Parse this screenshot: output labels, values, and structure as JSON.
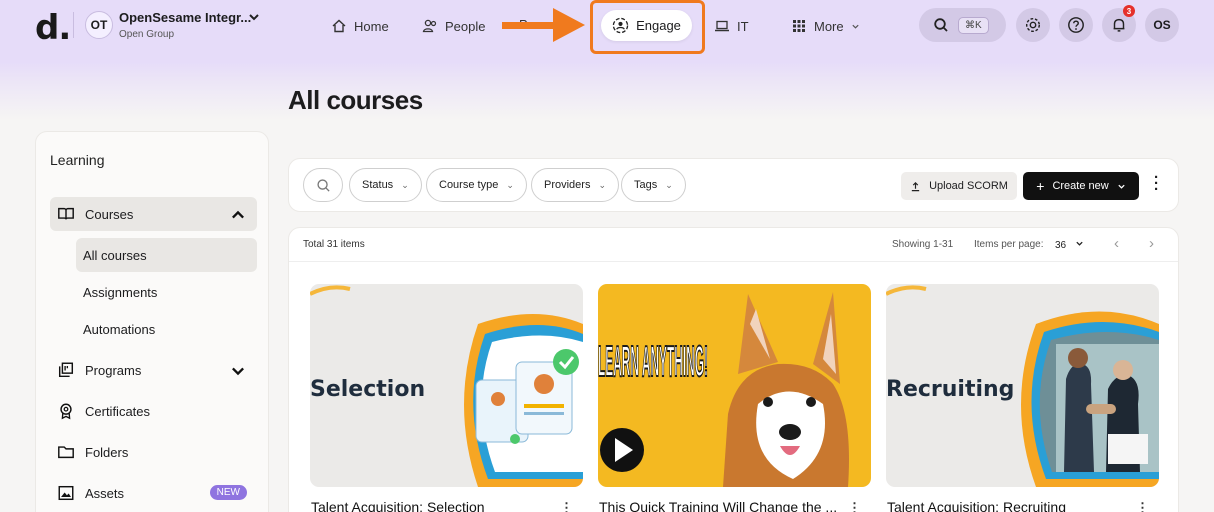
{
  "topbar": {
    "logo": "d.",
    "org": {
      "initials": "OT",
      "name": "OpenSesame Integr...",
      "subtitle": "Open Group"
    },
    "nav": [
      {
        "label": "Home",
        "icon": "home-icon"
      },
      {
        "label": "People",
        "icon": "people-icon"
      },
      {
        "label": "Engage",
        "icon": "engage-icon",
        "active": true
      },
      {
        "label": "IT",
        "icon": "laptop-icon"
      },
      {
        "label": "More",
        "icon": "grid-icon"
      }
    ],
    "partial_nav_text": "P",
    "search_shortcut": "⌘K",
    "notification_count": "3",
    "user_initials": "OS",
    "highlight_color": "#f07a1e",
    "accent_bg": "#e6dcf9"
  },
  "page": {
    "title": "All courses"
  },
  "sidebar": {
    "heading": "Learning",
    "items": [
      {
        "label": "Courses",
        "icon": "book-icon",
        "expanded": true
      },
      {
        "label": "Programs",
        "icon": "programs-icon"
      },
      {
        "label": "Certificates",
        "icon": "certificate-icon"
      },
      {
        "label": "Folders",
        "icon": "folder-icon"
      },
      {
        "label": "Assets",
        "icon": "image-icon",
        "badge": "NEW"
      }
    ],
    "sub_items": [
      {
        "label": "All courses",
        "active": true
      },
      {
        "label": "Assignments"
      },
      {
        "label": "Automations"
      }
    ]
  },
  "filters": {
    "chips": [
      "Status",
      "Course type",
      "Providers",
      "Tags"
    ],
    "upload_label": "Upload SCORM",
    "create_label": "Create new"
  },
  "list": {
    "total": "Total 31 items",
    "showing": "Showing 1-31",
    "per_page_label": "Items per page:",
    "per_page_value": "36"
  },
  "cards": [
    {
      "title": "Talent Acquisition: Selection",
      "thumb_text": "Selection"
    },
    {
      "title": "This Quick Training Will Change the ...",
      "thumb_text": "LEARN ANYTHING!"
    },
    {
      "title": "Talent Acquisition: Recruiting",
      "thumb_text": "Recruiting"
    }
  ]
}
